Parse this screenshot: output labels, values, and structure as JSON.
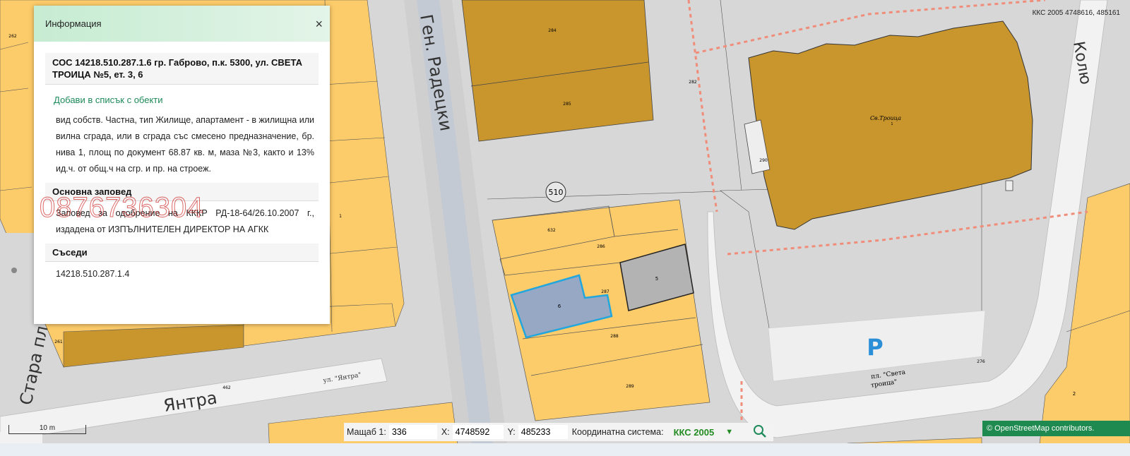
{
  "map": {
    "coordinate_readout": "ККС 2005 4748616, 485161",
    "streets": {
      "gen_radetski": "Ген. Радецки",
      "yantra": "Янтра",
      "ul_yantra": "ул. \"Янтра\"",
      "stara_pl": "Стара пл",
      "kolyu": "Колю",
      "pl_sveta_troitsa_1": "пл. \"Света",
      "pl_sveta_troitsa_2": "троица\""
    },
    "labels": {
      "church": "Св.Троица",
      "church_num": "1",
      "block": "510",
      "parking": "P",
      "p284": "284",
      "p285": "285",
      "p282": "282",
      "p290": "290",
      "p632": "632",
      "p286": "286",
      "p287": "287",
      "p288": "288",
      "p289": "289",
      "bld5": "5",
      "bld6": "6",
      "p462": "462",
      "p276": "276",
      "p262": "262",
      "p261": "261",
      "n2": "2",
      "n1": "1"
    }
  },
  "info_panel": {
    "title": "Информация",
    "close": "×",
    "object_title": "СОС 14218.510.287.1.6 гр. Габрово, п.к. 5300, ул. СВЕТА ТРОИЦА №5, ет. 3, 6",
    "add_link": "Добави в списък с обекти",
    "description": "вид собств. Частна, тип Жилище, апартамент - в жилищна или вилна сграда, или в сграда със смесено предназначение, бр. нива 1, площ по документ 68.87 кв. м, маза №3, както и 13% ид.ч. от общ.ч на сгр. и пр. на строеж.",
    "order_heading": "Основна заповед",
    "order_text": "Заповед за одобрение на КККР РД-18-64/26.10.2007 г., издадена от ИЗПЪЛНИТЕЛЕН ДИРЕКТОР НА АГКК",
    "neighbors_heading": "Съседи",
    "neighbor": "14218.510.287.1.4"
  },
  "watermark": "0876736304",
  "bottom_bar": {
    "scale_label": "Мащаб 1:",
    "scale_value": "336",
    "x_label": "X:",
    "x_value": "4748592",
    "y_label": "Y:",
    "y_value": "485233",
    "crs_label": "Координатна система:",
    "crs_value": "ККС 2005",
    "dropdown": "▼"
  },
  "osm": "© OpenStreetMap contributors.",
  "scale_bar": "10 m",
  "colors": {
    "parcel": "#fccb6a",
    "building": "#c9962e",
    "road": "#d7d7d7",
    "selected": "#97a8c4",
    "selected_border": "#21a6dd",
    "accent": "#1f8a5a"
  }
}
